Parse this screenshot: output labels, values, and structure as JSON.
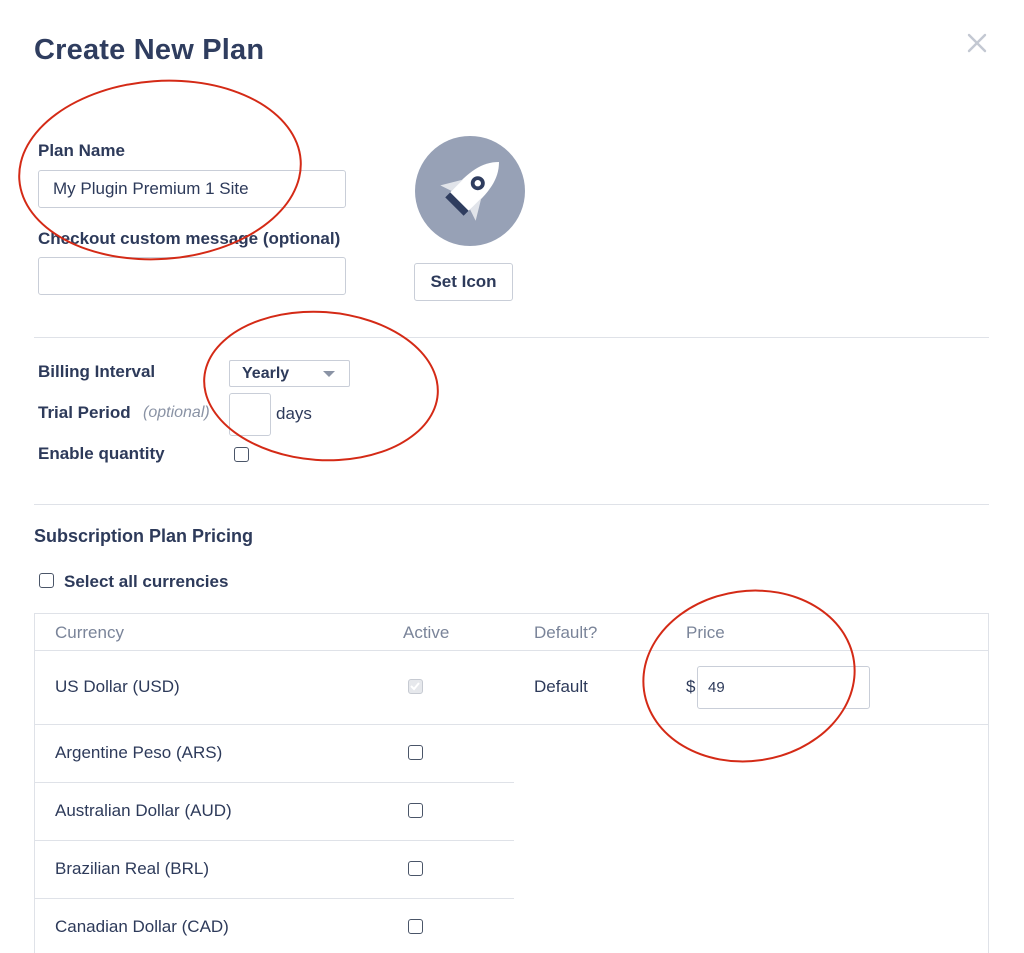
{
  "dialog": {
    "title": "Create New Plan"
  },
  "plan_name": {
    "label": "Plan Name",
    "value": "My Plugin Premium 1 Site"
  },
  "checkout_message": {
    "label": "Checkout custom message (optional)",
    "value": ""
  },
  "icon": {
    "name": "rocket-icon",
    "button_label": "Set Icon"
  },
  "billing": {
    "interval_label": "Billing Interval",
    "interval_value": "Yearly",
    "trial_label": "Trial Period",
    "trial_optional": "(optional)",
    "trial_value": "",
    "trial_unit": "days",
    "quantity_label": "Enable quantity",
    "quantity_enabled": false
  },
  "pricing": {
    "section_title": "Subscription Plan Pricing",
    "select_all_label": "Select all currencies",
    "columns": [
      "Currency",
      "Active",
      "Default?",
      "Price"
    ],
    "rows": [
      {
        "currency": "US Dollar (USD)",
        "active": true,
        "active_disabled": true,
        "default": "Default",
        "price_symbol": "$",
        "price": "49"
      },
      {
        "currency": "Argentine Peso (ARS)",
        "active": false
      },
      {
        "currency": "Australian Dollar (AUD)",
        "active": false
      },
      {
        "currency": "Brazilian Real (BRL)",
        "active": false
      },
      {
        "currency": "Canadian Dollar (CAD)",
        "active": false
      }
    ]
  },
  "colors": {
    "annotation": "#d42a16",
    "text": "#2d3a5a",
    "icon_bg": "#97a1b6"
  }
}
